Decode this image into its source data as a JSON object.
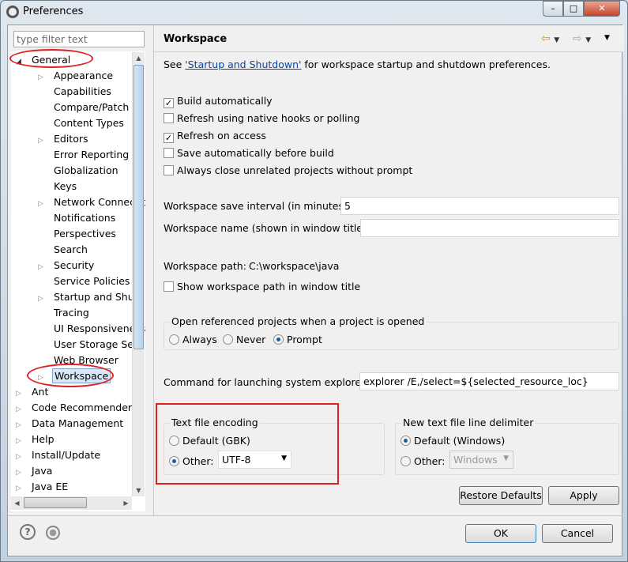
{
  "window": {
    "title": "Preferences",
    "min": "–",
    "max": "□",
    "close": "✕"
  },
  "filter": {
    "placeholder": "type filter text"
  },
  "tree": [
    {
      "label": "General",
      "level": 0,
      "expanded": true
    },
    {
      "label": "Appearance",
      "level": 1,
      "expander": true
    },
    {
      "label": "Capabilities",
      "level": 1
    },
    {
      "label": "Compare/Patch",
      "level": 1
    },
    {
      "label": "Content Types",
      "level": 1
    },
    {
      "label": "Editors",
      "level": 1,
      "expander": true
    },
    {
      "label": "Error Reporting",
      "level": 1
    },
    {
      "label": "Globalization",
      "level": 1
    },
    {
      "label": "Keys",
      "level": 1
    },
    {
      "label": "Network Connectio",
      "level": 1,
      "expander": true
    },
    {
      "label": "Notifications",
      "level": 1
    },
    {
      "label": "Perspectives",
      "level": 1
    },
    {
      "label": "Search",
      "level": 1
    },
    {
      "label": "Security",
      "level": 1,
      "expander": true
    },
    {
      "label": "Service Policies",
      "level": 1
    },
    {
      "label": "Startup and Shutd",
      "level": 1,
      "expander": true
    },
    {
      "label": "Tracing",
      "level": 1
    },
    {
      "label": "UI Responsiveness",
      "level": 1
    },
    {
      "label": "User Storage Serv",
      "level": 1
    },
    {
      "label": "Web Browser",
      "level": 1
    },
    {
      "label": "Workspace",
      "level": 1,
      "expander": true,
      "selected": true
    },
    {
      "label": "Ant",
      "level": 0,
      "expander": true
    },
    {
      "label": "Code Recommenders",
      "level": 0,
      "expander": true
    },
    {
      "label": "Data Management",
      "level": 0,
      "expander": true
    },
    {
      "label": "Help",
      "level": 0,
      "expander": true
    },
    {
      "label": "Install/Update",
      "level": 0,
      "expander": true
    },
    {
      "label": "Java",
      "level": 0,
      "expander": true
    },
    {
      "label": "Java EE",
      "level": 0,
      "expander": true
    }
  ],
  "page": {
    "title": "Workspace",
    "intro_prefix": "See ",
    "intro_link": "'Startup and Shutdown'",
    "intro_suffix": " for workspace startup and shutdown preferences.",
    "checks": [
      {
        "label": "Build automatically",
        "checked": true
      },
      {
        "label": "Refresh using native hooks or polling",
        "checked": false
      },
      {
        "label": "Refresh on access",
        "checked": true
      },
      {
        "label": "Save automatically before build",
        "checked": false
      },
      {
        "label": "Always close unrelated projects without prompt",
        "checked": false
      }
    ],
    "save_interval_label": "Workspace save interval (in minutes):",
    "save_interval": "5",
    "name_label": "Workspace name (shown in window title):",
    "name_value": "",
    "path_label": "Workspace path:",
    "path_value": "C:\\workspace\\java",
    "show_path_label": "Show workspace path in window title",
    "open_ref": {
      "label": "Open referenced projects when a project is opened",
      "options": [
        "Always",
        "Never",
        "Prompt"
      ],
      "selected": "Prompt"
    },
    "explorer_label": "Command for launching system explorer:",
    "explorer_value": "explorer /E,/select=${selected_resource_loc}",
    "encoding": {
      "label": "Text file encoding",
      "default": "Default (GBK)",
      "other": "Other:",
      "value": "UTF-8",
      "selected": "other"
    },
    "delimiter": {
      "label": "New text file line delimiter",
      "default": "Default (Windows)",
      "other": "Other:",
      "value": "Windows",
      "selected": "default"
    },
    "restore": "Restore Defaults",
    "apply": "Apply"
  },
  "footer": {
    "help": "?",
    "ok": "OK",
    "cancel": "Cancel"
  },
  "colors": {
    "highlight": "#e02020",
    "link": "#0645ad"
  }
}
